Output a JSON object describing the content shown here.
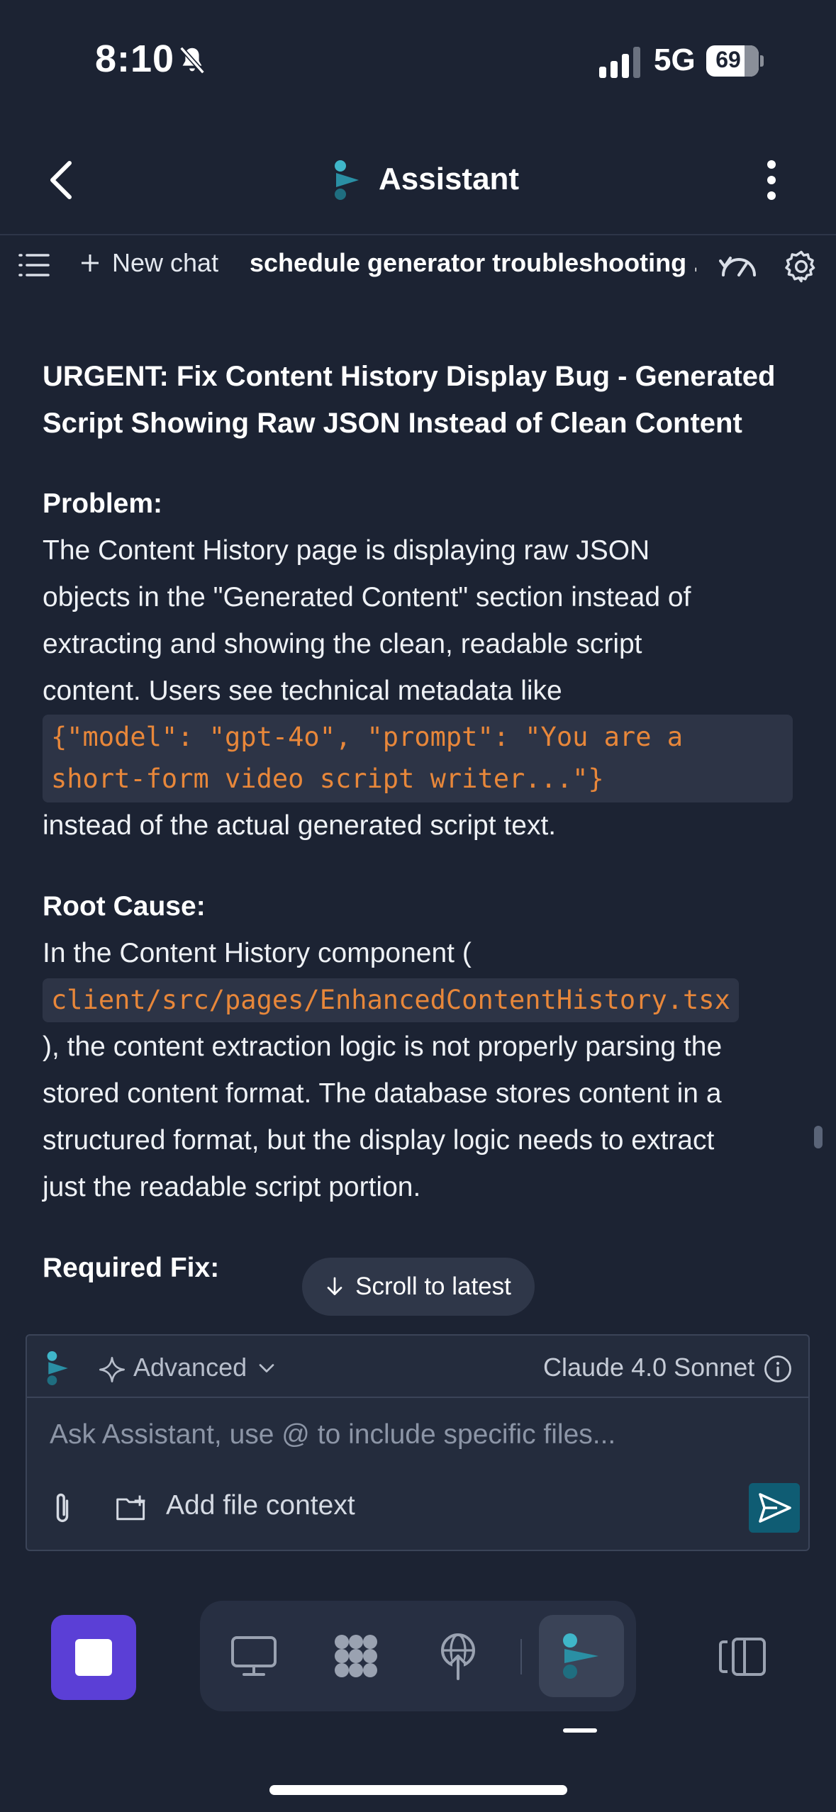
{
  "status_bar": {
    "time": "8:10",
    "network": "5G",
    "battery": "69"
  },
  "header": {
    "title": "Assistant"
  },
  "toolbar": {
    "new_chat_label": "New chat",
    "chat_title": "schedule generator troubleshooting ..."
  },
  "message": {
    "heading_line1": "URGENT: Fix Content History Display Bug - Generated",
    "heading_line2": "Script Showing Raw JSON Instead of Clean Content",
    "problem_label": "Problem:",
    "problem_l1": "The Content History page is displaying raw JSON",
    "problem_l2": "objects in the \"Generated Content\" section instead of",
    "problem_l3": "extracting and showing the clean, readable script",
    "problem_l4": "content. Users see technical metadata like",
    "problem_code_l1": "{\"model\": \"gpt-4o\", \"prompt\": \"You are a",
    "problem_code_l2": "short-form video script writer...\"}",
    "problem_l5": "instead of the actual generated script text.",
    "root_cause_label": "Root Cause:",
    "root_l1": "In the Content History component (",
    "root_code": "client/src/pages/EnhancedContentHistory.tsx",
    "root_l2": "), the content extraction logic is not properly parsing the",
    "root_l3": "stored content format. The database stores content in a",
    "root_l4": "structured format, but the display logic needs to extract",
    "root_l5": "just the readable script portion.",
    "required_fix_label": "Required Fix:"
  },
  "scroll_to_latest_label": "Scroll to latest",
  "composer": {
    "mode_label": "Advanced",
    "model_label": "Claude 4.0 Sonnet",
    "placeholder": "Ask Assistant, use @ to include specific files...",
    "add_file_context_label": "Add file context"
  },
  "colors": {
    "background": "#1c2333",
    "code_text": "#e8873a",
    "accent_stop": "#5b3fd6",
    "send_button": "#0f5c73"
  },
  "icons": [
    "bell-slash-icon",
    "signal-icon",
    "battery-icon",
    "back-chevron-icon",
    "assistant-logo-icon",
    "kebab-menu-icon",
    "list-icon",
    "plus-icon",
    "gauge-icon",
    "gear-icon",
    "arrow-down-icon",
    "sparkle-icon",
    "chevron-down-icon",
    "info-icon",
    "paperclip-icon",
    "folder-plus-icon",
    "send-icon",
    "stop-icon",
    "monitor-icon",
    "apps-grid-icon",
    "deploy-icon",
    "panel-toggle-icon"
  ]
}
